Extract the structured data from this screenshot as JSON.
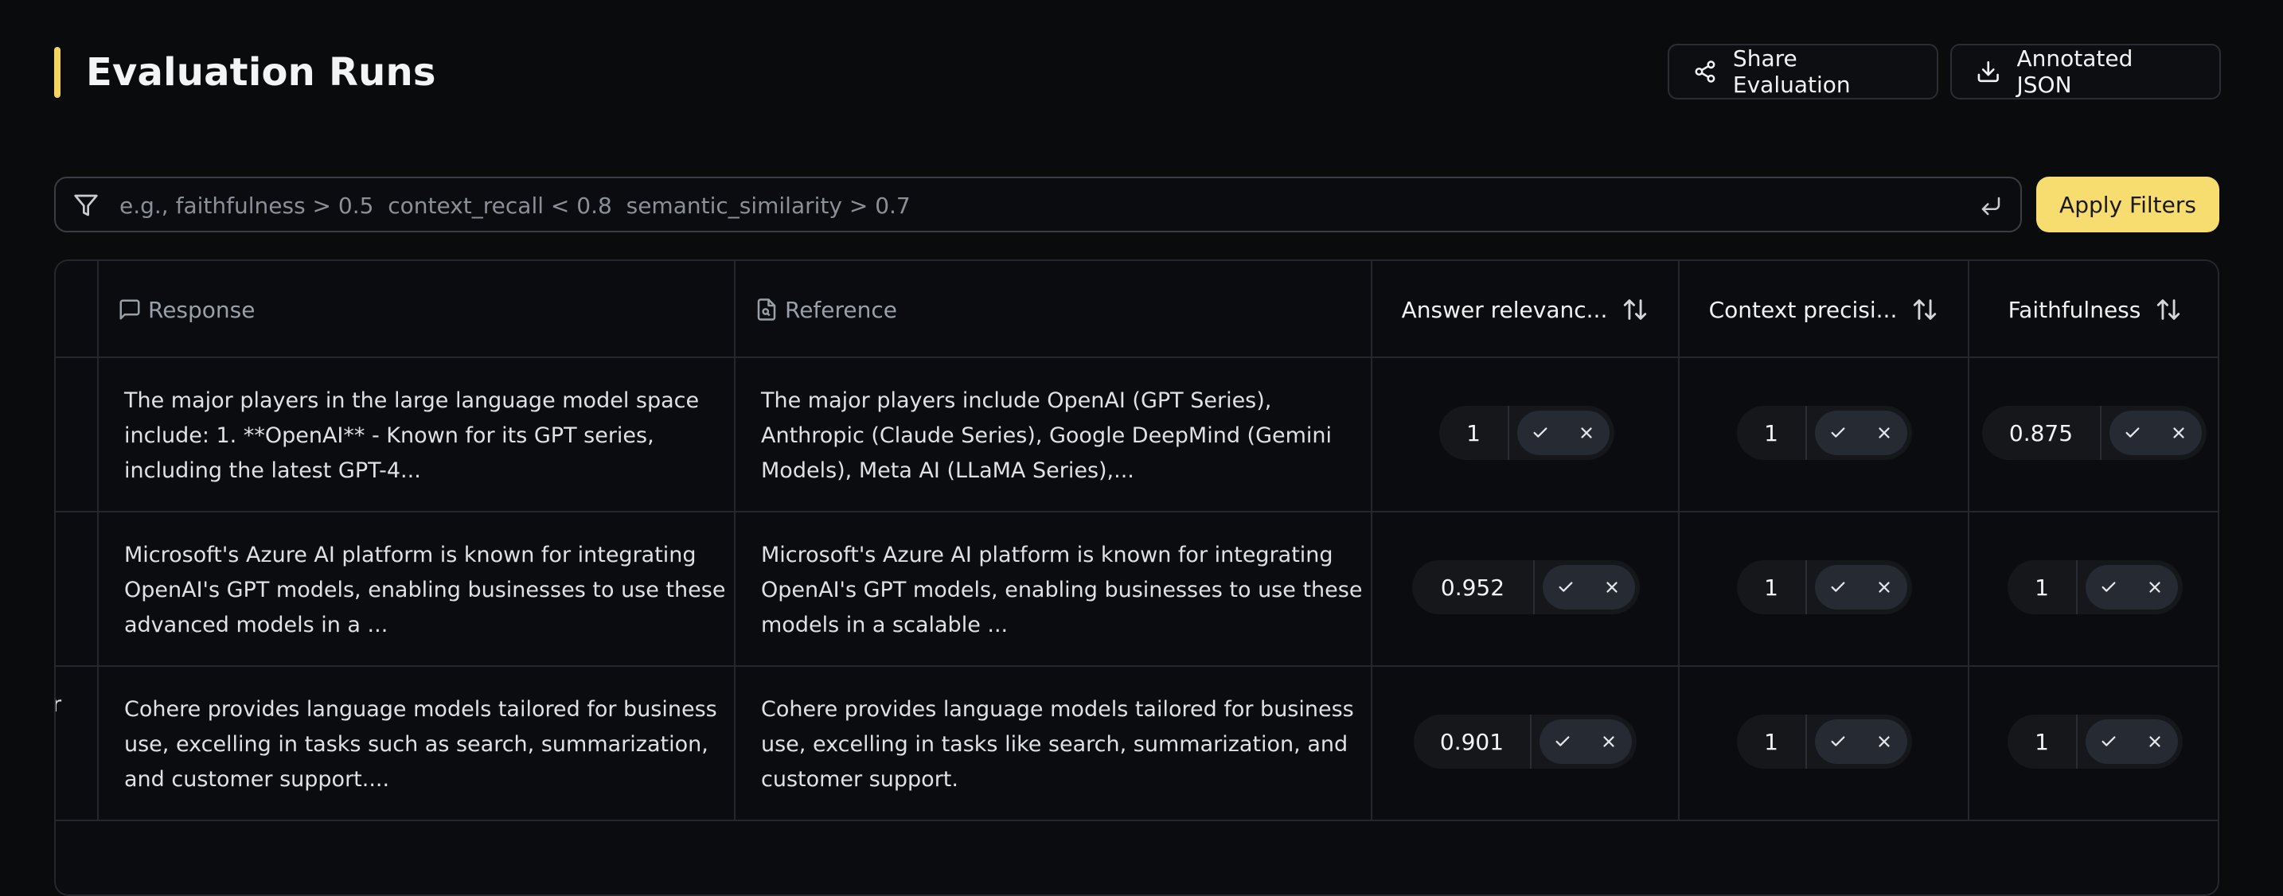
{
  "header": {
    "title": "Evaluation Runs",
    "share_label": "Share Evaluation",
    "json_label": "Annotated JSON"
  },
  "filter": {
    "placeholder": "e.g., faithfulness > 0.5  context_recall < 0.8  semantic_similarity > 0.7",
    "apply_label": "Apply Filters"
  },
  "table": {
    "columns": {
      "response": "Response",
      "reference": "Reference",
      "answer_relevancy": "Answer relevanc...",
      "context_precision": "Context precisi...",
      "faithfulness": "Faithfulness"
    },
    "rows": [
      {
        "left_fragment": "",
        "response": "The major players in the large language model space include: 1. **OpenAI** - Known for its GPT series, including the latest GPT-4...",
        "reference": "The major players include OpenAI (GPT Series), Anthropic (Claude Series), Google DeepMind (Gemini Models), Meta AI (LLaMA Series),...",
        "answer_relevancy": "1",
        "context_precision": "1",
        "faithfulness": "0.875"
      },
      {
        "left_fragment": "",
        "response": "Microsoft's Azure AI platform is known for integrating OpenAI's GPT models, enabling businesses to use these advanced models in a ...",
        "reference": "Microsoft's Azure AI platform is known for integrating OpenAI's GPT models, enabling businesses to use these models in a scalable ...",
        "answer_relevancy": "0.952",
        "context_precision": "1",
        "faithfulness": "1"
      },
      {
        "left_fragment": "r",
        "response": "Cohere provides language models tailored for business use, excelling in tasks such as search, summarization, and customer support....",
        "reference": "Cohere provides language models tailored for business use, excelling in tasks like search, summarization, and customer support.",
        "answer_relevancy": "0.901",
        "context_precision": "1",
        "faithfulness": "1"
      }
    ]
  },
  "icons": {
    "share": "share-icon",
    "download": "download-icon",
    "filter": "filter-icon",
    "enter": "enter-icon",
    "response": "message-square-icon",
    "reference": "file-search-icon",
    "sort": "sort-arrows-icon",
    "check": "check-icon",
    "close": "close-icon"
  },
  "colors": {
    "background": "#0a0b0d",
    "accent": "#f4d35e",
    "apply_button": "#f7dc6f"
  }
}
